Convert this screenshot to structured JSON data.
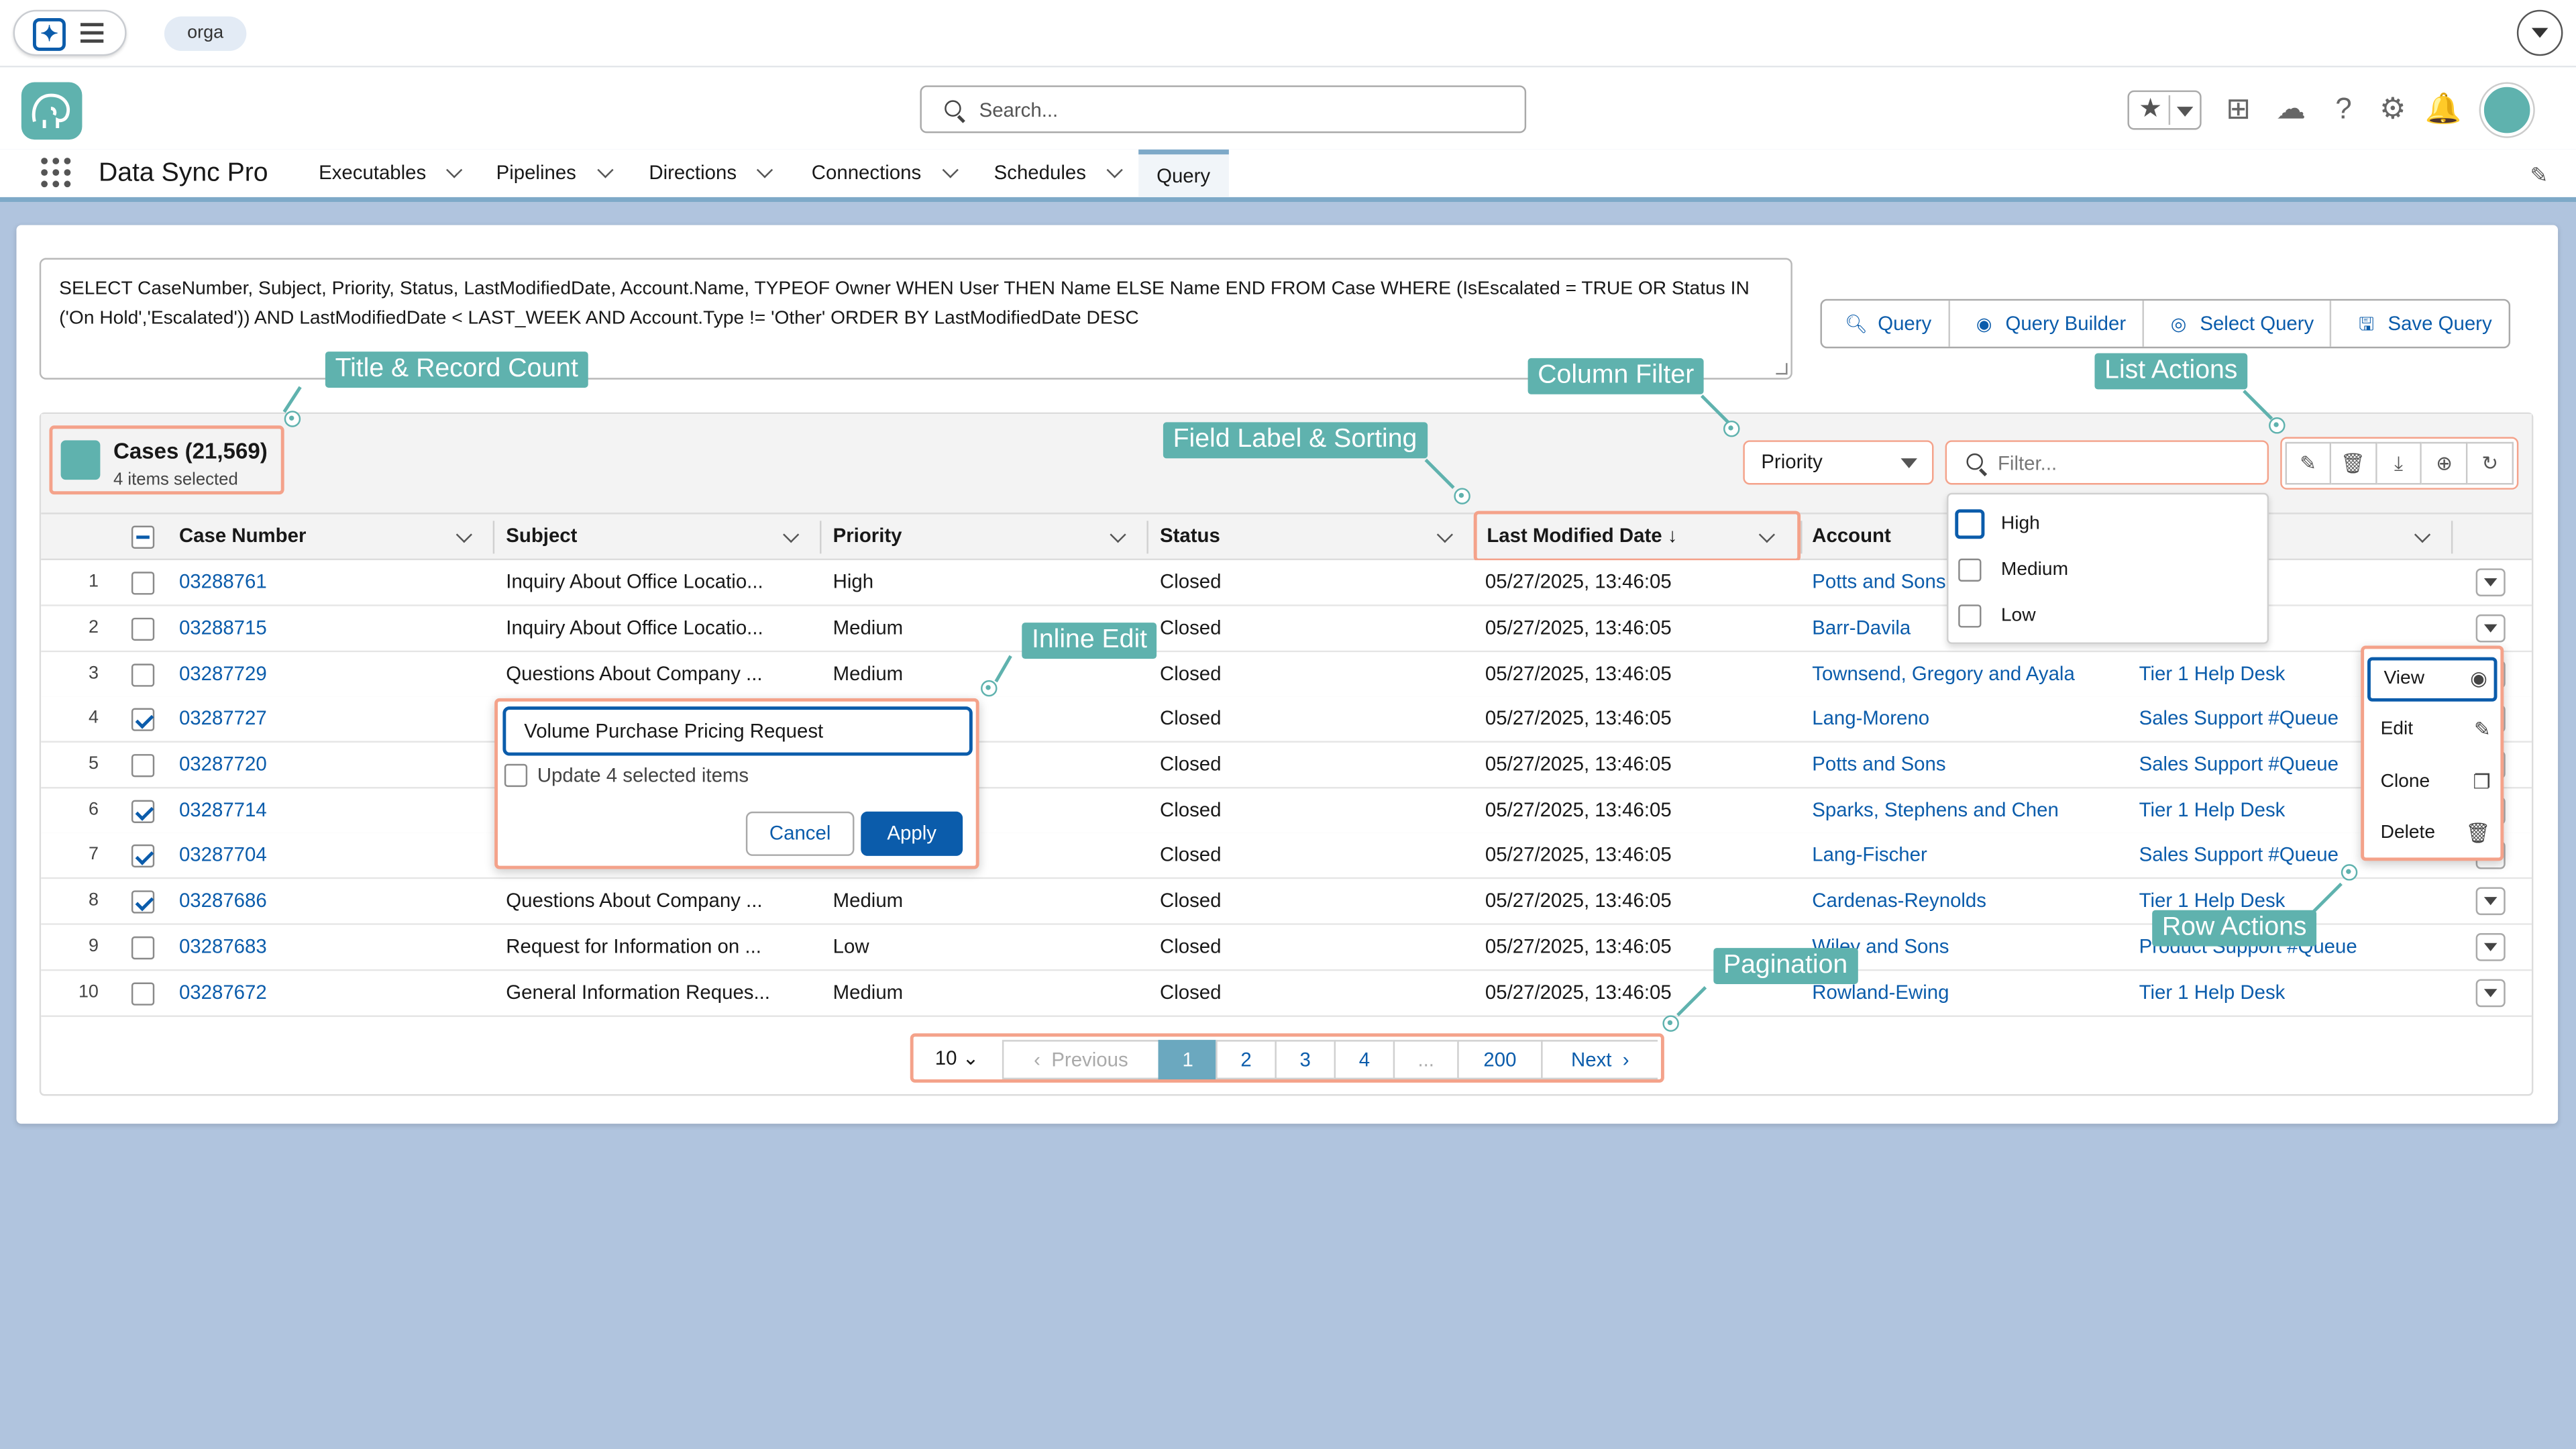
{
  "system": {
    "org_label": "orga"
  },
  "header": {
    "search_placeholder": "Search...",
    "app_name": "Data Sync Pro"
  },
  "nav": {
    "items": [
      {
        "label": "Executables"
      },
      {
        "label": "Pipelines"
      },
      {
        "label": "Directions"
      },
      {
        "label": "Connections"
      },
      {
        "label": "Schedules"
      },
      {
        "label": "Query"
      }
    ],
    "active": "Query"
  },
  "query": {
    "soql": "SELECT CaseNumber, Subject, Priority, Status, LastModifiedDate, Account.Name, TYPEOF Owner WHEN User THEN Name ELSE Name END FROM Case WHERE (IsEscalated = TRUE OR Status IN ('On Hold','Escalated')) AND LastModifiedDate < LAST_WEEK AND Account.Type != 'Other' ORDER BY LastModifiedDate DESC",
    "buttons": [
      "Query",
      "Query Builder",
      "Select Query",
      "Save Query"
    ]
  },
  "list": {
    "title": "Cases (21,569)",
    "subtitle": "4 items selected",
    "column_filter_field": "Priority",
    "filter_placeholder": "Filter...",
    "columns": [
      "Case Number",
      "Subject",
      "Priority",
      "Status",
      "Last Modified Date ↓",
      "Account",
      ""
    ],
    "rows": [
      {
        "n": "1",
        "checked": false,
        "case": "03288761",
        "subject": "Inquiry About Office Locatio...",
        "priority": "High",
        "status": "Closed",
        "date": "05/27/2025, 13:46:05",
        "account": "Potts and Sons",
        "owner": "k"
      },
      {
        "n": "2",
        "checked": false,
        "case": "03288715",
        "subject": "Inquiry About Office Locatio...",
        "priority": "Medium",
        "status": "Closed",
        "date": "05/27/2025, 13:46:05",
        "account": "Barr-Davila",
        "owner": "k"
      },
      {
        "n": "3",
        "checked": false,
        "case": "03287729",
        "subject": "Questions About Company ...",
        "priority": "Medium",
        "status": "Closed",
        "date": "05/27/2025, 13:46:05",
        "account": "Townsend, Gregory and Ayala",
        "owner": "Tier 1 Help Desk"
      },
      {
        "n": "4",
        "checked": true,
        "case": "03287727",
        "subject": "",
        "priority": "",
        "status": "Closed",
        "date": "05/27/2025, 13:46:05",
        "account": "Lang-Moreno",
        "owner": "Sales Support #Queue"
      },
      {
        "n": "5",
        "checked": false,
        "case": "03287720",
        "subject": "",
        "priority": "",
        "status": "Closed",
        "date": "05/27/2025, 13:46:05",
        "account": "Potts and Sons",
        "owner": "Sales Support #Queue"
      },
      {
        "n": "6",
        "checked": true,
        "case": "03287714",
        "subject": "",
        "priority": "",
        "status": "Closed",
        "date": "05/27/2025, 13:46:05",
        "account": "Sparks, Stephens and Chen",
        "owner": "Tier 1 Help Desk"
      },
      {
        "n": "7",
        "checked": true,
        "case": "03287704",
        "subject": "",
        "priority": "",
        "status": "Closed",
        "date": "05/27/2025, 13:46:05",
        "account": "Lang-Fischer",
        "owner": "Sales Support #Queue"
      },
      {
        "n": "8",
        "checked": true,
        "case": "03287686",
        "subject": "Questions About Company ...",
        "priority": "Medium",
        "status": "Closed",
        "date": "05/27/2025, 13:46:05",
        "account": "Cardenas-Reynolds",
        "owner": "Tier 1 Help Desk"
      },
      {
        "n": "9",
        "checked": false,
        "case": "03287683",
        "subject": "Request for Information on ...",
        "priority": "Low",
        "status": "Closed",
        "date": "05/27/2025, 13:46:05",
        "account": "Wiley and Sons",
        "owner": "Product Support #Queue"
      },
      {
        "n": "10",
        "checked": false,
        "case": "03287672",
        "subject": "General Information Reques...",
        "priority": "Medium",
        "status": "Closed",
        "date": "05/27/2025, 13:46:05",
        "account": "Rowland-Ewing",
        "owner": "Tier 1 Help Desk"
      }
    ]
  },
  "priority_options": [
    "High",
    "Medium",
    "Low"
  ],
  "inline_edit": {
    "value": "Volume Purchase Pricing Request",
    "update_label": "Update 4 selected items",
    "cancel": "Cancel",
    "apply": "Apply"
  },
  "row_actions": [
    "View",
    "Edit",
    "Clone",
    "Delete"
  ],
  "pagination": {
    "page_size": "10",
    "previous": "Previous",
    "pages": [
      "1",
      "2",
      "3",
      "4",
      "...",
      "200"
    ],
    "current": "1",
    "next": "Next"
  },
  "callouts": {
    "title_record_count": "Title & Record Count",
    "column_filter": "Column Filter",
    "list_actions": "List Actions",
    "field_label_sorting": "Field Label & Sorting",
    "inline_edit": "Inline Edit",
    "row_actions": "Row Actions",
    "pagination": "Pagination"
  },
  "colors": {
    "accent": "#0b5cab",
    "callout": "#5fb2ae",
    "highlight_border": "#f4a28a",
    "page_bg": "#b0c4de"
  }
}
